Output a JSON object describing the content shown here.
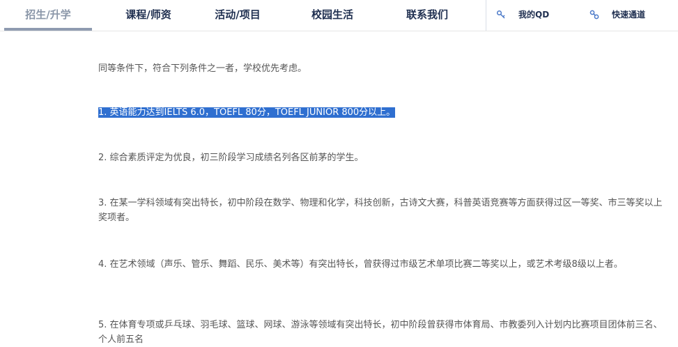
{
  "nav": {
    "items": [
      {
        "label": "招生/升学",
        "active": true
      },
      {
        "label": "课程/师资",
        "active": false
      },
      {
        "label": "活动/项目",
        "active": false
      },
      {
        "label": "校园生活",
        "active": false
      },
      {
        "label": "联系我们",
        "active": false
      }
    ],
    "my_qd": {
      "label": "我的QD",
      "icon": "key-icon"
    },
    "quick_access": {
      "label": "快速通道",
      "icon": "link-icon"
    }
  },
  "content": {
    "intro": "同等条件下，符合下列条件之一者，学校优先考虑。",
    "items": [
      "1.  英语能力达到IELTS 6.0，TOEFL 80分，TOEFL JUNIOR 800分以上。",
      "2.  综合素质评定为优良，初三阶段学习成绩名列各区前茅的学生。",
      "3.  在某一学科领域有突出特长，初中阶段在数学、物理和化学，科技创新，古诗文大赛，科普英语竞赛等方面获得过区一等奖、市三等奖以上奖项者。",
      "4.  在艺术领域（声乐、管乐、舞蹈、民乐、美术等）有突出特长，曾获得过市级艺术单项比赛二等奖以上，或艺术考级8级以上者。",
      "5.  在体育专项或乒乓球、羽毛球、篮球、网球、游泳等领域有突出特长，初中阶段曾获得市体育局、市教委列入计划内比赛项目团体前三名、个人前五名"
    ]
  },
  "colors": {
    "nav_text": "#1f2f50",
    "nav_active": "#8a96a8",
    "selection": "#2f6fd0",
    "body_text": "#555555"
  }
}
